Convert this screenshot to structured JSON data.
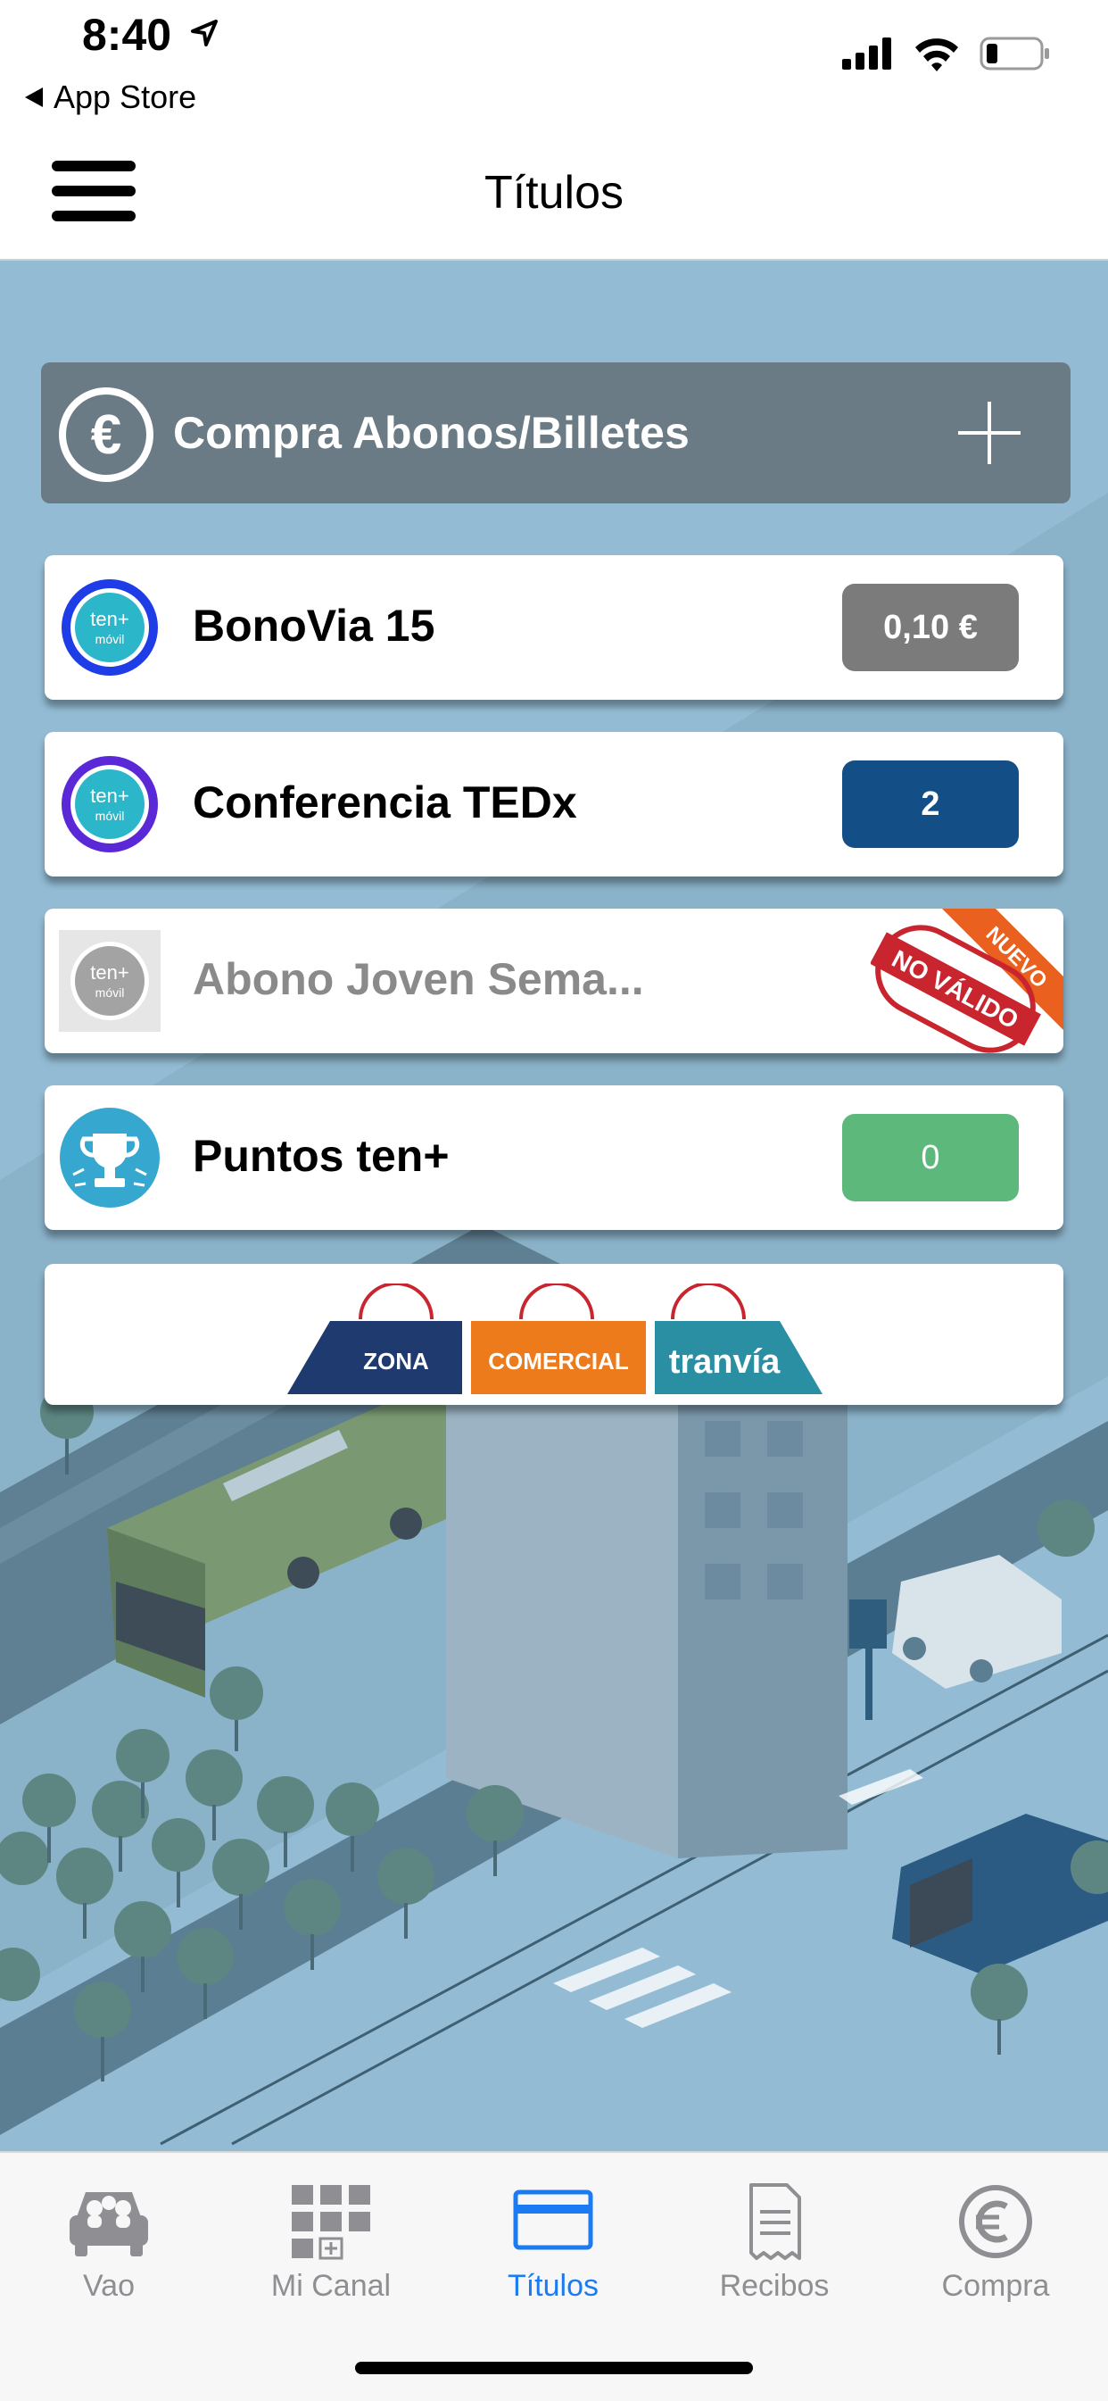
{
  "status": {
    "time": "8:40",
    "back_label": "App Store"
  },
  "nav": {
    "title": "Títulos"
  },
  "buy_bar": {
    "label": "Compra Abonos/Billetes"
  },
  "titles": [
    {
      "name": "BonoVia 15",
      "badge": "0,10 €",
      "badge_color": "#7b7b7b",
      "icon": "ten-movil-icon",
      "icon_ring": "#1f3de6"
    },
    {
      "name": "Conferencia TEDx",
      "badge": "2",
      "badge_color": "#134f86",
      "icon": "ten-movil-icon",
      "icon_ring": "#5b28d8"
    },
    {
      "name": "Abono Joven Sema...",
      "stamp_text": "NO VÁLIDO",
      "ribbon_text": "NUEVO",
      "icon": "ten-movil-icon-grey"
    },
    {
      "name": "Puntos ten+",
      "badge": "0",
      "badge_color": "#5cb97b",
      "icon": "trophy-icon"
    }
  ],
  "icon_text": {
    "ten": "ten+",
    "movil": "móvil"
  },
  "promo": {
    "words": [
      "ZONA",
      "COMERCIAL",
      "tranvía"
    ],
    "colors": [
      "#1f3a6e",
      "#ee7b1b",
      "#2a8fa3"
    ]
  },
  "tabs": [
    {
      "label": "Vao",
      "icon": "car-pool-icon"
    },
    {
      "label": "Mi Canal",
      "icon": "grid-channel-icon"
    },
    {
      "label": "Títulos",
      "icon": "ticket-card-icon",
      "active": true
    },
    {
      "label": "Recibos",
      "icon": "receipt-icon"
    },
    {
      "label": "Compra",
      "icon": "euro-circle-icon"
    }
  ],
  "colors": {
    "accent": "#1a7bf2",
    "background": "#93bcd4",
    "buy_bar": "#6a7b86"
  }
}
